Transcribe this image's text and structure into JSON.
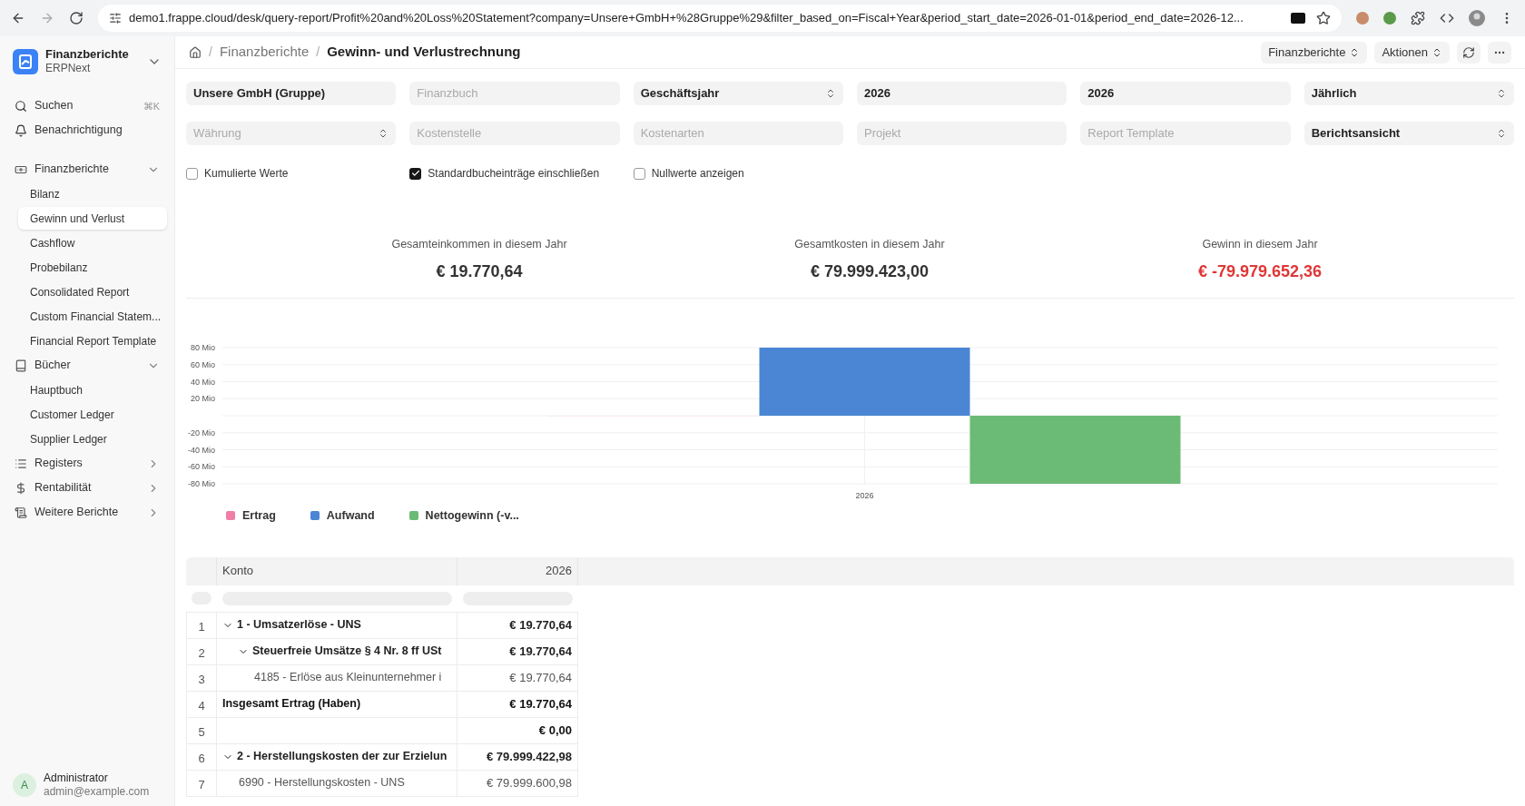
{
  "browser": {
    "url": "demo1.frappe.cloud/desk/query-report/Profit%20and%20Loss%20Statement?company=Unsere+GmbH+%28Gruppe%29&filter_based_on=Fiscal+Year&period_start_date=2026-01-01&period_end_date=2026-12..."
  },
  "sidebar": {
    "app": {
      "title": "Finanzberichte",
      "subtitle": "ERPNext"
    },
    "search": {
      "label": "Suchen",
      "shortcut": "⌘K"
    },
    "notification": {
      "label": "Benachrichtigung"
    },
    "sections": [
      {
        "label": "Finanzberichte",
        "kind": "banknote",
        "expanded": true,
        "items": [
          {
            "label": "Bilanz",
            "selected": false
          },
          {
            "label": "Gewinn und Verlust",
            "selected": true
          },
          {
            "label": "Cashflow",
            "selected": false
          },
          {
            "label": "Probebilanz",
            "selected": false
          },
          {
            "label": "Consolidated Report",
            "selected": false
          },
          {
            "label": "Custom Financial Statem...",
            "selected": false
          },
          {
            "label": "Financial Report Template",
            "selected": false
          }
        ]
      },
      {
        "label": "Bücher",
        "kind": "book",
        "expanded": true,
        "items": [
          {
            "label": "Hauptbuch",
            "selected": false
          },
          {
            "label": "Customer Ledger",
            "selected": false
          },
          {
            "label": "Supplier Ledger",
            "selected": false
          }
        ]
      },
      {
        "label": "Registers",
        "kind": "list",
        "expanded": false
      },
      {
        "label": "Rentabilität",
        "kind": "dollar",
        "expanded": false
      },
      {
        "label": "Weitere Berichte",
        "kind": "scroll",
        "expanded": false
      }
    ],
    "user": {
      "initial": "A",
      "name": "Administrator",
      "email": "admin@example.com"
    }
  },
  "header": {
    "separator": "/",
    "breadcrumbs": [
      "Finanzberichte"
    ],
    "title": "Gewinn- und Verlustrechnung",
    "buttons": [
      "Finanzberichte",
      "Aktionen"
    ]
  },
  "filters": [
    {
      "kind": "text",
      "value": "Unsere GmbH (Gruppe)"
    },
    {
      "kind": "text",
      "placeholder": "Finanzbuch"
    },
    {
      "kind": "select",
      "value": "Geschäftsjahr"
    },
    {
      "kind": "text",
      "value": "2026"
    },
    {
      "kind": "text",
      "value": "2026"
    },
    {
      "kind": "select",
      "value": "Jährlich"
    },
    {
      "kind": "select",
      "placeholder": "Währung"
    },
    {
      "kind": "text",
      "placeholder": "Kostenstelle"
    },
    {
      "kind": "text",
      "placeholder": "Kostenarten"
    },
    {
      "kind": "text",
      "placeholder": "Projekt"
    },
    {
      "kind": "text",
      "placeholder": "Report Template"
    },
    {
      "kind": "select",
      "value": "Berichtsansicht"
    }
  ],
  "checkboxes": [
    {
      "label": "Kumulierte Werte",
      "checked": false
    },
    {
      "label": "Standardbucheinträge einschließen",
      "checked": true
    },
    {
      "label": "Nullwerte anzeigen",
      "checked": false
    }
  ],
  "summary": [
    {
      "label": "Gesamteinkommen in diesem Jahr",
      "value": "€ 19.770,64",
      "negative": false
    },
    {
      "label": "Gesamtkosten in diesem Jahr",
      "value": "€ 79.999.423,00",
      "negative": false
    },
    {
      "label": "Gewinn in diesem Jahr",
      "value": "€ -79.979.652,36",
      "negative": true
    }
  ],
  "chart_data": {
    "type": "bar",
    "grid": true,
    "legend": true,
    "categories": [
      "2026"
    ],
    "series": [
      {
        "name": "Ertrag",
        "color": "#f07ea6",
        "values": [
          0
        ]
      },
      {
        "name": "Aufwand",
        "color": "#4a86d4",
        "values": [
          80
        ]
      },
      {
        "name": "Nettogewinn (-v...",
        "color": "#6bba75",
        "values": [
          -80
        ]
      }
    ],
    "ylim": [
      -80,
      80
    ],
    "yticks": [
      {
        "value": 80,
        "label": "80 Mio"
      },
      {
        "value": 60,
        "label": "60 Mio"
      },
      {
        "value": 40,
        "label": "40 Mio"
      },
      {
        "value": 20,
        "label": "20 Mio"
      },
      {
        "value": -20,
        "label": "-20 Mio"
      },
      {
        "value": -40,
        "label": "-40 Mio"
      },
      {
        "value": -60,
        "label": "-60 Mio"
      },
      {
        "value": -80,
        "label": "-80 Mio"
      }
    ]
  },
  "table": {
    "columns": [
      "Konto",
      "2026"
    ],
    "rows": [
      {
        "index": "1",
        "kind": "group",
        "account": "1 - Umsatzerlöse - UNS",
        "value": "€ 19.770,64",
        "expanded": true,
        "children": [
          {
            "index": "2",
            "kind": "group",
            "account": "Steuerfreie Umsätze § 4 Nr. 8 ff USt",
            "value": "€ 19.770,64",
            "expanded": true,
            "children": [
              {
                "index": "3",
                "kind": "account",
                "account": "4185 - Erlöse aus Kleinunternehmer i",
                "value": "€ 19.770,64"
              }
            ]
          }
        ]
      },
      {
        "index": "4",
        "kind": "total",
        "account": "Insgesamt Ertrag (Haben)",
        "value": "€ 19.770,64"
      },
      {
        "index": "5",
        "kind": "total",
        "value": "€ 0,00"
      },
      {
        "index": "6",
        "kind": "group",
        "account": "2 - Herstellungskosten der zur Erzielun",
        "value": "€ 79.999.422,98",
        "expanded": true,
        "children": [
          {
            "index": "7",
            "kind": "account",
            "account": "6990 - Herstellungskosten - UNS",
            "value": "€ 79.999.600,98"
          }
        ]
      }
    ]
  }
}
